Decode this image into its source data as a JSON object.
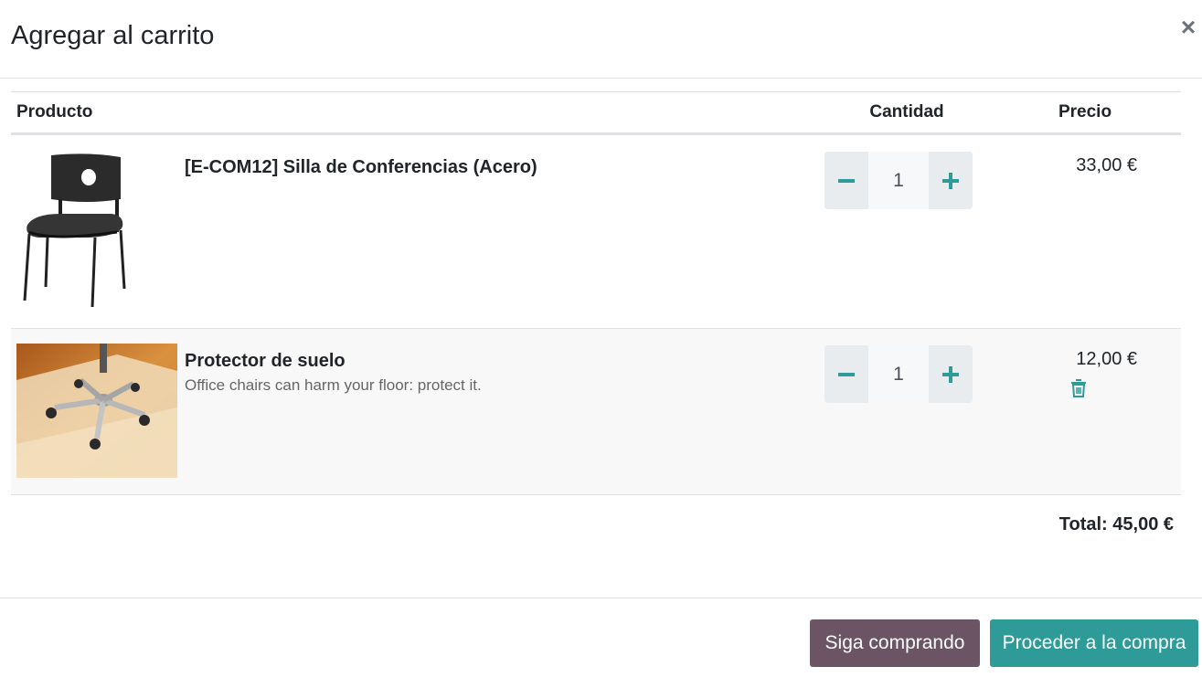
{
  "dialog": {
    "title": "Agregar al carrito",
    "close_label": "×"
  },
  "table": {
    "headers": {
      "product": "Producto",
      "quantity": "Cantidad",
      "price": "Precio"
    },
    "rows": [
      {
        "name": "[E-COM12] Silla de Conferencias (Acero)",
        "description": "",
        "quantity": "1",
        "price": "33,00 €",
        "image": "black-conference-chair"
      },
      {
        "name": "Protector de suelo",
        "description": "Office chairs can harm your floor: protect it.",
        "quantity": "1",
        "price": "12,00 €",
        "image": "floor-protector-mat"
      }
    ]
  },
  "total": "Total: 45,00 €",
  "footer": {
    "continue_label": "Siga comprando",
    "checkout_label": "Proceder a la compra"
  },
  "colors": {
    "accent": "#2e9b99",
    "secondary": "#6b5565",
    "plus_icon": "#2e9b99",
    "minus_icon": "#2e9b99"
  }
}
